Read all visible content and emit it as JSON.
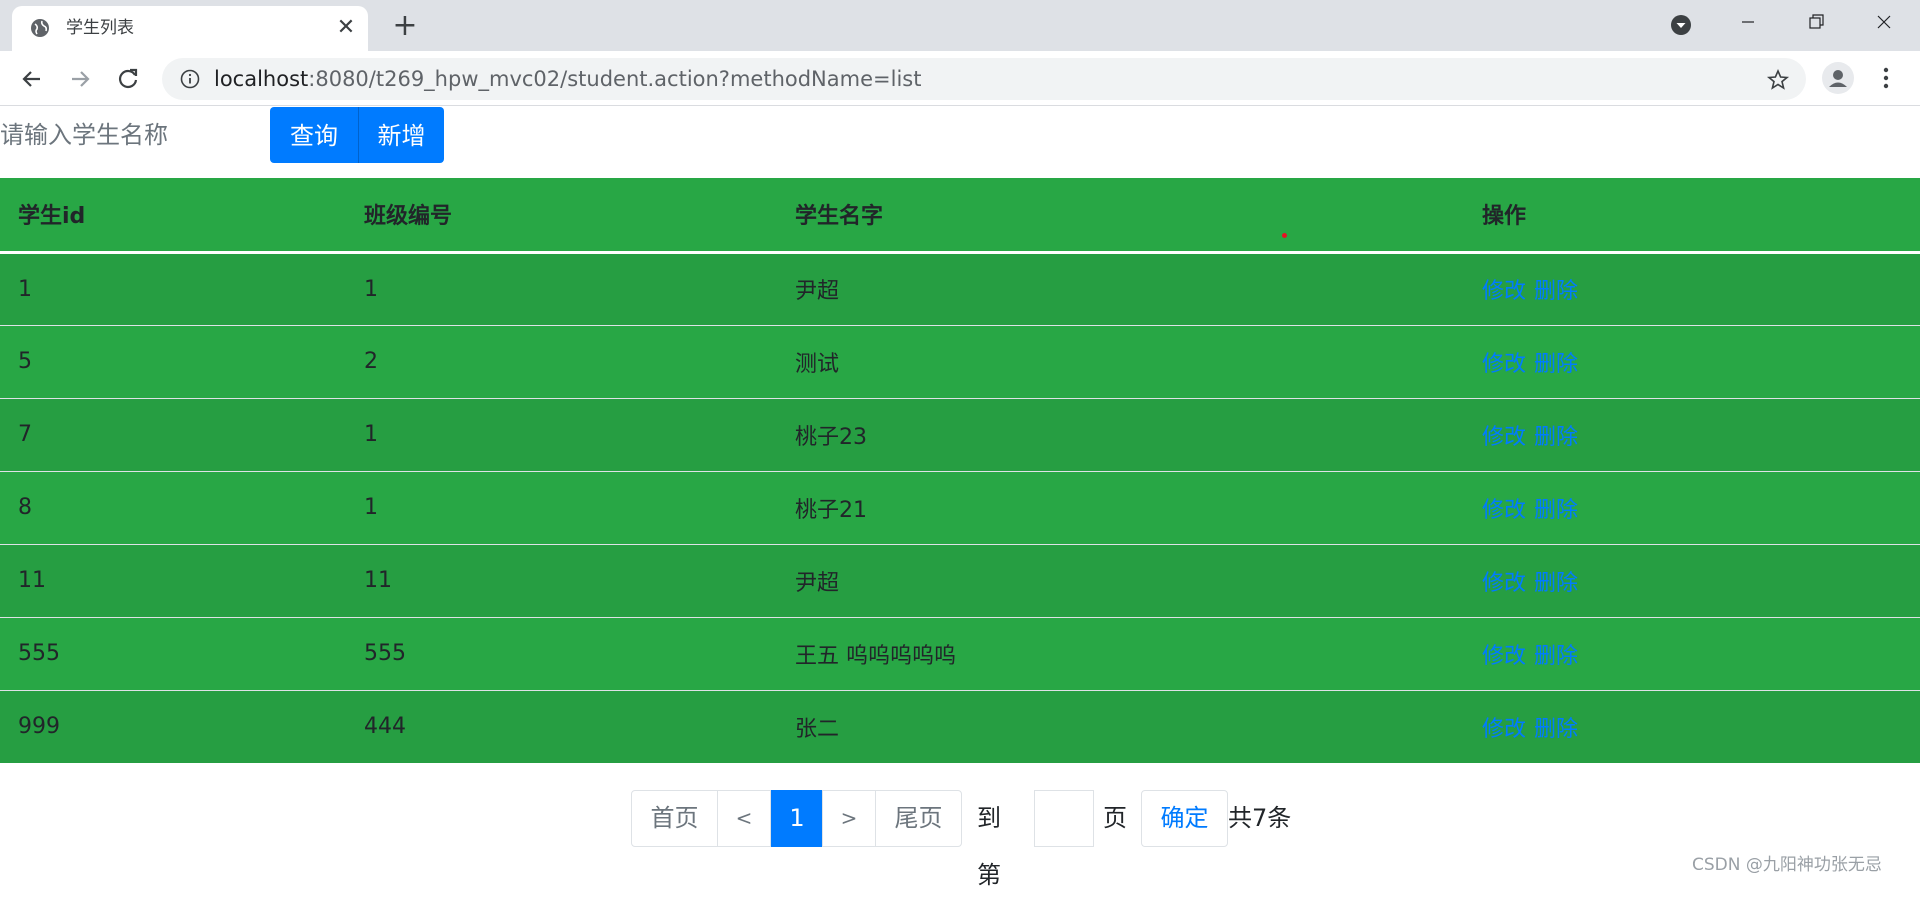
{
  "browser": {
    "tab_title": "学生列表",
    "url_host": "localhost",
    "url_rest": ":8080/t269_hpw_mvc02/student.action?methodName=list",
    "icons": {
      "favicon": "globe-icon",
      "close": "close-icon",
      "new_tab": "plus-icon",
      "back": "arrow-left-icon",
      "forward": "arrow-right-icon",
      "reload": "reload-icon",
      "info": "info-icon",
      "star": "star-icon",
      "profile": "avatar-icon",
      "menu": "more-vertical-icon"
    }
  },
  "search": {
    "placeholder": "请输入学生名称",
    "query_label": "查询",
    "add_label": "新增"
  },
  "table": {
    "headers": [
      "学生id",
      "班级编号",
      "学生名字",
      "操作"
    ],
    "rows": [
      {
        "id": "1",
        "class_no": "1",
        "name": "尹超"
      },
      {
        "id": "5",
        "class_no": "2",
        "name": "测试"
      },
      {
        "id": "7",
        "class_no": "1",
        "name": "桃子23"
      },
      {
        "id": "8",
        "class_no": "1",
        "name": "桃子21"
      },
      {
        "id": "11",
        "class_no": "11",
        "name": "尹超"
      },
      {
        "id": "555",
        "class_no": "555",
        "name": "王五 呜呜呜呜呜"
      },
      {
        "id": "999",
        "class_no": "444",
        "name": "张二"
      }
    ],
    "edit_label": "修改",
    "delete_label": "删除"
  },
  "pagination": {
    "first": "首页",
    "prev": "<",
    "current": "1",
    "next": ">",
    "last": "尾页",
    "goto_label": "到第",
    "page_label": "页",
    "confirm": "确定",
    "total": "共7条"
  },
  "watermark": "CSDN @九阳神功张无忌",
  "colors": {
    "table_bg": "#28a745",
    "table_bg_alt": "#269e42",
    "primary": "#007bff"
  }
}
